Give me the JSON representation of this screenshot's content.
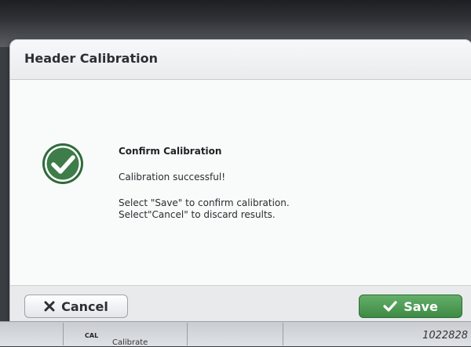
{
  "dialog": {
    "title": "Header Calibration",
    "message_title": "Confirm Calibration",
    "message": "Calibration successful!",
    "instruction_1": "Select \"Save\" to confirm calibration.",
    "instruction_2": "Select\"Cancel\" to discard results.",
    "success_icon": "checkmark-circle-icon",
    "cancel_label": "Cancel",
    "save_label": "Save"
  },
  "background": {
    "cal_label": "CAL",
    "cal_text": "Calibrate",
    "number": "1022828"
  },
  "colors": {
    "success_green": "#3e7d49",
    "save_button": "#4e9e55"
  }
}
